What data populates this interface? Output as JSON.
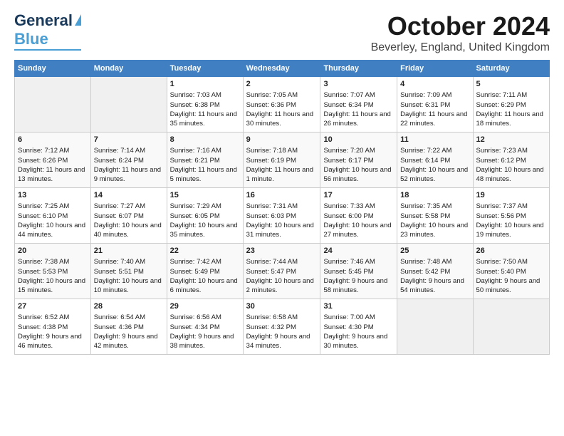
{
  "logo": {
    "line1": "General",
    "line2": "Blue"
  },
  "title": "October 2024",
  "subtitle": "Beverley, England, United Kingdom",
  "days_of_week": [
    "Sunday",
    "Monday",
    "Tuesday",
    "Wednesday",
    "Thursday",
    "Friday",
    "Saturday"
  ],
  "weeks": [
    [
      {
        "day": "",
        "empty": true
      },
      {
        "day": "",
        "empty": true
      },
      {
        "day": "1",
        "sunrise": "Sunrise: 7:03 AM",
        "sunset": "Sunset: 6:38 PM",
        "daylight": "Daylight: 11 hours and 35 minutes."
      },
      {
        "day": "2",
        "sunrise": "Sunrise: 7:05 AM",
        "sunset": "Sunset: 6:36 PM",
        "daylight": "Daylight: 11 hours and 30 minutes."
      },
      {
        "day": "3",
        "sunrise": "Sunrise: 7:07 AM",
        "sunset": "Sunset: 6:34 PM",
        "daylight": "Daylight: 11 hours and 26 minutes."
      },
      {
        "day": "4",
        "sunrise": "Sunrise: 7:09 AM",
        "sunset": "Sunset: 6:31 PM",
        "daylight": "Daylight: 11 hours and 22 minutes."
      },
      {
        "day": "5",
        "sunrise": "Sunrise: 7:11 AM",
        "sunset": "Sunset: 6:29 PM",
        "daylight": "Daylight: 11 hours and 18 minutes."
      }
    ],
    [
      {
        "day": "6",
        "sunrise": "Sunrise: 7:12 AM",
        "sunset": "Sunset: 6:26 PM",
        "daylight": "Daylight: 11 hours and 13 minutes."
      },
      {
        "day": "7",
        "sunrise": "Sunrise: 7:14 AM",
        "sunset": "Sunset: 6:24 PM",
        "daylight": "Daylight: 11 hours and 9 minutes."
      },
      {
        "day": "8",
        "sunrise": "Sunrise: 7:16 AM",
        "sunset": "Sunset: 6:21 PM",
        "daylight": "Daylight: 11 hours and 5 minutes."
      },
      {
        "day": "9",
        "sunrise": "Sunrise: 7:18 AM",
        "sunset": "Sunset: 6:19 PM",
        "daylight": "Daylight: 11 hours and 1 minute."
      },
      {
        "day": "10",
        "sunrise": "Sunrise: 7:20 AM",
        "sunset": "Sunset: 6:17 PM",
        "daylight": "Daylight: 10 hours and 56 minutes."
      },
      {
        "day": "11",
        "sunrise": "Sunrise: 7:22 AM",
        "sunset": "Sunset: 6:14 PM",
        "daylight": "Daylight: 10 hours and 52 minutes."
      },
      {
        "day": "12",
        "sunrise": "Sunrise: 7:23 AM",
        "sunset": "Sunset: 6:12 PM",
        "daylight": "Daylight: 10 hours and 48 minutes."
      }
    ],
    [
      {
        "day": "13",
        "sunrise": "Sunrise: 7:25 AM",
        "sunset": "Sunset: 6:10 PM",
        "daylight": "Daylight: 10 hours and 44 minutes."
      },
      {
        "day": "14",
        "sunrise": "Sunrise: 7:27 AM",
        "sunset": "Sunset: 6:07 PM",
        "daylight": "Daylight: 10 hours and 40 minutes."
      },
      {
        "day": "15",
        "sunrise": "Sunrise: 7:29 AM",
        "sunset": "Sunset: 6:05 PM",
        "daylight": "Daylight: 10 hours and 35 minutes."
      },
      {
        "day": "16",
        "sunrise": "Sunrise: 7:31 AM",
        "sunset": "Sunset: 6:03 PM",
        "daylight": "Daylight: 10 hours and 31 minutes."
      },
      {
        "day": "17",
        "sunrise": "Sunrise: 7:33 AM",
        "sunset": "Sunset: 6:00 PM",
        "daylight": "Daylight: 10 hours and 27 minutes."
      },
      {
        "day": "18",
        "sunrise": "Sunrise: 7:35 AM",
        "sunset": "Sunset: 5:58 PM",
        "daylight": "Daylight: 10 hours and 23 minutes."
      },
      {
        "day": "19",
        "sunrise": "Sunrise: 7:37 AM",
        "sunset": "Sunset: 5:56 PM",
        "daylight": "Daylight: 10 hours and 19 minutes."
      }
    ],
    [
      {
        "day": "20",
        "sunrise": "Sunrise: 7:38 AM",
        "sunset": "Sunset: 5:53 PM",
        "daylight": "Daylight: 10 hours and 15 minutes."
      },
      {
        "day": "21",
        "sunrise": "Sunrise: 7:40 AM",
        "sunset": "Sunset: 5:51 PM",
        "daylight": "Daylight: 10 hours and 10 minutes."
      },
      {
        "day": "22",
        "sunrise": "Sunrise: 7:42 AM",
        "sunset": "Sunset: 5:49 PM",
        "daylight": "Daylight: 10 hours and 6 minutes."
      },
      {
        "day": "23",
        "sunrise": "Sunrise: 7:44 AM",
        "sunset": "Sunset: 5:47 PM",
        "daylight": "Daylight: 10 hours and 2 minutes."
      },
      {
        "day": "24",
        "sunrise": "Sunrise: 7:46 AM",
        "sunset": "Sunset: 5:45 PM",
        "daylight": "Daylight: 9 hours and 58 minutes."
      },
      {
        "day": "25",
        "sunrise": "Sunrise: 7:48 AM",
        "sunset": "Sunset: 5:42 PM",
        "daylight": "Daylight: 9 hours and 54 minutes."
      },
      {
        "day": "26",
        "sunrise": "Sunrise: 7:50 AM",
        "sunset": "Sunset: 5:40 PM",
        "daylight": "Daylight: 9 hours and 50 minutes."
      }
    ],
    [
      {
        "day": "27",
        "sunrise": "Sunrise: 6:52 AM",
        "sunset": "Sunset: 4:38 PM",
        "daylight": "Daylight: 9 hours and 46 minutes."
      },
      {
        "day": "28",
        "sunrise": "Sunrise: 6:54 AM",
        "sunset": "Sunset: 4:36 PM",
        "daylight": "Daylight: 9 hours and 42 minutes."
      },
      {
        "day": "29",
        "sunrise": "Sunrise: 6:56 AM",
        "sunset": "Sunset: 4:34 PM",
        "daylight": "Daylight: 9 hours and 38 minutes."
      },
      {
        "day": "30",
        "sunrise": "Sunrise: 6:58 AM",
        "sunset": "Sunset: 4:32 PM",
        "daylight": "Daylight: 9 hours and 34 minutes."
      },
      {
        "day": "31",
        "sunrise": "Sunrise: 7:00 AM",
        "sunset": "Sunset: 4:30 PM",
        "daylight": "Daylight: 9 hours and 30 minutes."
      },
      {
        "day": "",
        "empty": true
      },
      {
        "day": "",
        "empty": true
      }
    ]
  ]
}
